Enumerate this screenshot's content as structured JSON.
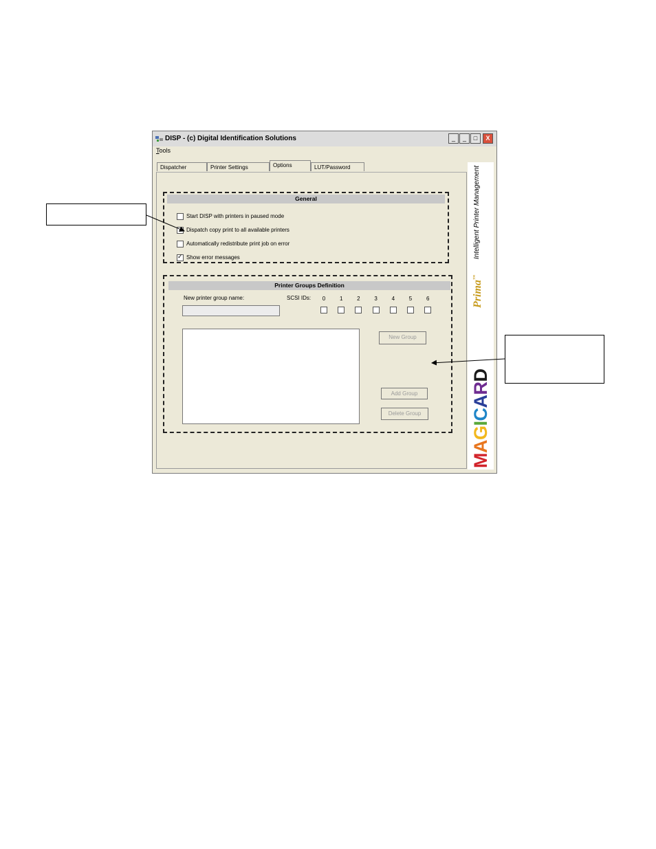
{
  "window": {
    "title": "DISP - (c) Digital Identification Solutions",
    "controls": [
      "_",
      "_",
      "□",
      "X"
    ],
    "menu": [
      {
        "accel": "T",
        "rest": "ools"
      }
    ]
  },
  "tabs": [
    "Dispatcher",
    "Printer Settings",
    "Options",
    "LUT/Password"
  ],
  "active_tab": "Options",
  "general": {
    "header": "General",
    "options": [
      {
        "label": "Start DISP with printers in paused mode",
        "checked": false
      },
      {
        "label": "Dispatch copy print to all available printers",
        "checked": false
      },
      {
        "label": "Automatically redistribute print job on error",
        "checked": false
      },
      {
        "label": "Show error messages",
        "checked": true
      }
    ]
  },
  "printer_groups": {
    "header": "Printer Groups Definition",
    "new_group_name_label": "New printer group name:",
    "new_group_name_value": "",
    "scsi_label": "SCSI IDs:",
    "scsi_ids": [
      "0",
      "1",
      "2",
      "3",
      "4",
      "5",
      "6"
    ],
    "buttons": {
      "new_group": "New Group",
      "add_group": "Add Group",
      "delete_group": "Delete Group"
    }
  },
  "logo": {
    "tagline": "Intelligent Printer Management",
    "prima": "Prima",
    "prima_mark": "™",
    "brand_letters": [
      "M",
      "A",
      "G",
      "I",
      "C",
      "A",
      "R",
      "D"
    ],
    "brand_colors": [
      "#d2232a",
      "#e8761e",
      "#f2b81d",
      "#5aa83a",
      "#1f86c8",
      "#2a3f99",
      "#6f2c91",
      "#1a1a1a"
    ]
  },
  "colors": {
    "window_bg": "#ece9d8",
    "close_button": "#d9503c",
    "prima_gold": "#c79b1d"
  }
}
